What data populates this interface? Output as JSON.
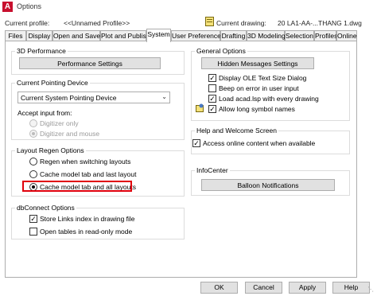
{
  "window": {
    "title": "Options"
  },
  "profile": {
    "label": "Current profile:",
    "value": "<<Unnamed Profile>>",
    "drawing_label": "Current drawing:",
    "drawing_value": "20 LA1-AA-...THANG 1.dwg"
  },
  "tabs": [
    {
      "label": "Files"
    },
    {
      "label": "Display"
    },
    {
      "label": "Open and Save"
    },
    {
      "label": "Plot and Publish"
    },
    {
      "label": "System"
    },
    {
      "label": "User Preferences"
    },
    {
      "label": "Drafting"
    },
    {
      "label": "3D Modeling"
    },
    {
      "label": "Selection"
    },
    {
      "label": "Profiles"
    },
    {
      "label": "Online"
    }
  ],
  "active_tab": "System",
  "perf": {
    "title": "3D Performance",
    "button": "Performance Settings"
  },
  "pointing": {
    "title": "Current Pointing Device",
    "selected": "Current System Pointing Device",
    "accept_label": "Accept input from:",
    "opt1": "Digitizer only",
    "opt2": "Digitizer and mouse"
  },
  "regen": {
    "title": "Layout Regen Options",
    "opt1": "Regen when switching layouts",
    "opt2": "Cache model tab and last layout",
    "opt3": "Cache model tab and all layouts"
  },
  "dbconnect": {
    "title": "dbConnect Options",
    "opt1": "Store Links index in drawing file",
    "opt2": "Open tables in read-only mode"
  },
  "general": {
    "title": "General Options",
    "button": "Hidden Messages Settings",
    "opt1": "Display OLE Text Size Dialog",
    "opt2": "Beep on error in user input",
    "opt3": "Load acad.lsp with every drawing",
    "opt4": "Allow long symbol names"
  },
  "help": {
    "title": "Help and Welcome Screen",
    "opt1": "Access online content when available"
  },
  "infocenter": {
    "title": "InfoCenter",
    "button": "Balloon Notifications"
  },
  "buttons": {
    "ok": "OK",
    "cancel": "Cancel",
    "apply": "Apply",
    "help": "Help"
  },
  "colors": {
    "highlight": "#e0000c",
    "app_icon": "#c8102e"
  }
}
